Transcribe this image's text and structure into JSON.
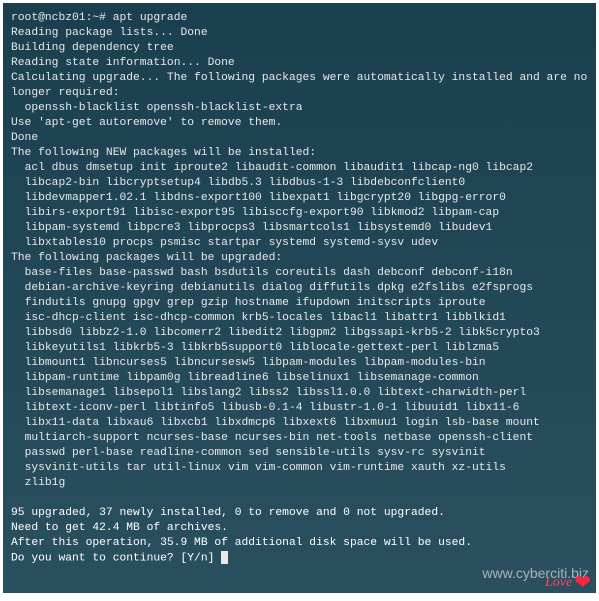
{
  "terminal": {
    "prompt": "root@ncbz01:~# ",
    "command": "apt upgrade",
    "lines": [
      "Reading package lists... Done",
      "Building dependency tree",
      "Reading state information... Done",
      "Calculating upgrade... The following packages were automatically installed and are no longer required:",
      "  openssh-blacklist openssh-blacklist-extra",
      "Use 'apt-get autoremove' to remove them.",
      "Done",
      "The following NEW packages will be installed:",
      "  acl dbus dmsetup init iproute2 libaudit-common libaudit1 libcap-ng0 libcap2",
      "  libcap2-bin libcryptsetup4 libdb5.3 libdbus-1-3 libdebconfclient0",
      "  libdevmapper1.02.1 libdns-export100 libexpat1 libgcrypt20 libgpg-error0",
      "  libirs-export91 libisc-export95 libisccfg-export90 libkmod2 libpam-cap",
      "  libpam-systemd libpcre3 libprocps3 libsmartcols1 libsystemd0 libudev1",
      "  libxtables10 procps psmisc startpar systemd systemd-sysv udev",
      "The following packages will be upgraded:",
      "  base-files base-passwd bash bsdutils coreutils dash debconf debconf-i18n",
      "  debian-archive-keyring debianutils dialog diffutils dpkg e2fslibs e2fsprogs",
      "  findutils gnupg gpgv grep gzip hostname ifupdown initscripts iproute",
      "  isc-dhcp-client isc-dhcp-common krb5-locales libacl1 libattr1 libblkid1",
      "  libbsd0 libbz2-1.0 libcomerr2 libedit2 libgpm2 libgssapi-krb5-2 libk5crypto3",
      "  libkeyutils1 libkrb5-3 libkrb5support0 liblocale-gettext-perl liblzma5",
      "  libmount1 libncurses5 libncursesw5 libpam-modules libpam-modules-bin",
      "  libpam-runtime libpam0g libreadline6 libselinux1 libsemanage-common",
      "  libsemanage1 libsepol1 libslang2 libss2 libssl1.0.0 libtext-charwidth-perl",
      "  libtext-iconv-perl libtinfo5 libusb-0.1-4 libustr-1.0-1 libuuid1 libx11-6",
      "  libx11-data libxau6 libxcb1 libxdmcp6 libxext6 libxmuu1 login lsb-base mount",
      "  multiarch-support ncurses-base ncurses-bin net-tools netbase openssh-client",
      "  passwd perl-base readline-common sed sensible-utils sysv-rc sysvinit",
      "  sysvinit-utils tar util-linux vim vim-common vim-runtime xauth xz-utils",
      "  zlib1g"
    ],
    "summary": "95 upgraded, 37 newly installed, 0 to remove and 0 not upgraded.",
    "download": "Need to get 42.4 MB of archives.",
    "diskspace": "After this operation, 35.9 MB of additional disk space will be used.",
    "confirm": "Do you want to continue? [Y/n] "
  },
  "watermark": "www.cyberciti.biz",
  "love_text": "Love"
}
